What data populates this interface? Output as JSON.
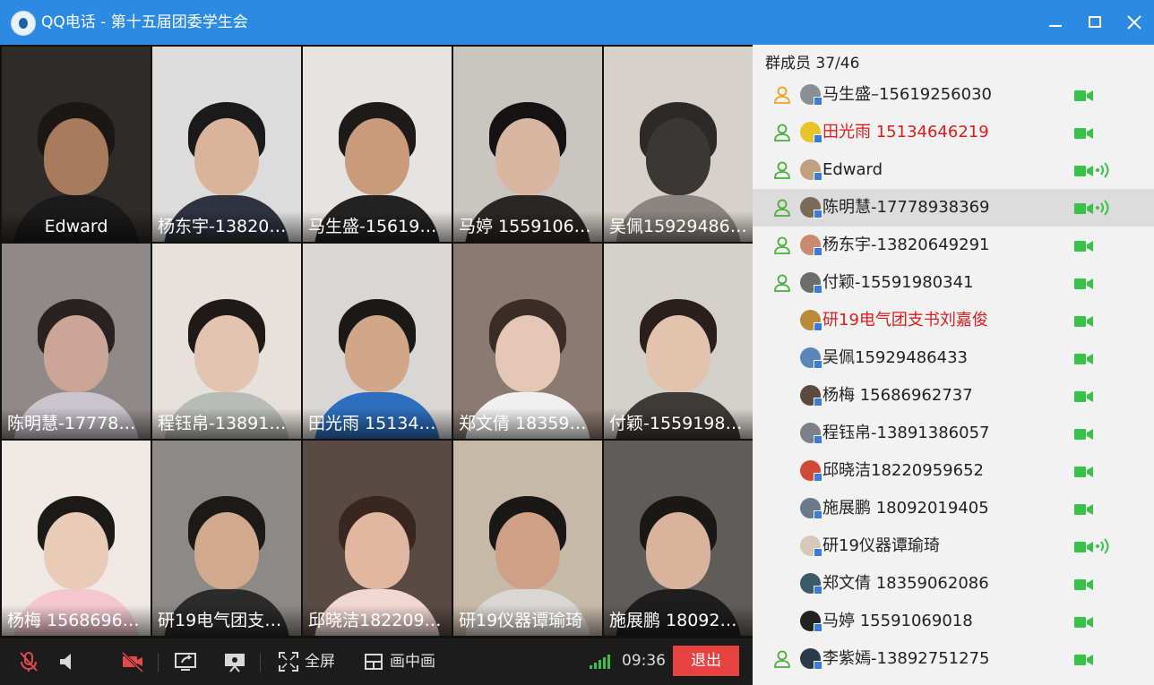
{
  "window": {
    "title": "QQ电话  -  第十五届团委学生会"
  },
  "tiles": [
    {
      "label": "Edward",
      "bg": "#2e2b28",
      "skin": "#a87b5c",
      "hair": "#1a1715",
      "shirt": "#1a1a1a",
      "center": true
    },
    {
      "label": "杨东宇-13820649291",
      "bg": "#dcdcdc",
      "skin": "#d9b39a",
      "hair": "#1b1a1a",
      "shirt": "#2f3340"
    },
    {
      "label": "马生盛-15619256030",
      "bg": "#e6e4e2",
      "skin": "#c99b7a",
      "hair": "#1c1b1a",
      "shirt": "#222222"
    },
    {
      "label": "马婷  15591069018",
      "bg": "#c9c5c0",
      "skin": "#d8b6a2",
      "hair": "#141212",
      "shirt": "#2a2626"
    },
    {
      "label": "吴佩15929486433",
      "bg": "#d6d2cb",
      "skin": "#3a3835",
      "hair": "#2b2a28",
      "shirt": "#8a8580"
    },
    {
      "label": "陈明慧-17778938369",
      "bg": "#8f8a88",
      "skin": "#cba596",
      "hair": "#2a2222",
      "shirt": "#c9c5cc"
    },
    {
      "label": "程钰帛-13891386057",
      "bg": "#e6e1da",
      "skin": "#e2c4b0",
      "hair": "#1e1a18",
      "shirt": "#b9bbb8"
    },
    {
      "label": "田光雨 15134646219",
      "bg": "#d9d7d6",
      "skin": "#d2a788",
      "hair": "#1b1918",
      "shirt": "#2c6fbe"
    },
    {
      "label": "郑文倩 18359062086",
      "bg": "#8b7a70",
      "skin": "#e4c7b5",
      "hair": "#3a2d28",
      "shirt": "#f0f0f0"
    },
    {
      "label": "付颖-15591980341",
      "bg": "#d3d1c9",
      "skin": "#e2c3ad",
      "hair": "#2a1f1a",
      "shirt": "#3d3b38"
    },
    {
      "label": "杨梅 15686962737",
      "bg": "#efe8e5",
      "skin": "#e8ccb8",
      "hair": "#1c1a19",
      "shirt": "#f4c7d0"
    },
    {
      "label": "研19电气团支书刘嘉俊",
      "bg": "#8c8a86",
      "skin": "#d1a98e",
      "hair": "#1b1a19",
      "shirt": "#2b2b2b"
    },
    {
      "label": "邱晓洁18220959652",
      "bg": "#5a4a44",
      "skin": "#e0b8a2",
      "hair": "#3a2620",
      "shirt": "#f2d6d2"
    },
    {
      "label": "研19仪器谭瑜琦",
      "bg": "#c7b9a8",
      "skin": "#cfa085",
      "hair": "#1a1816",
      "shirt": "#d9d7d3"
    },
    {
      "label": "施展鹏 18092019405",
      "bg": "#5f5d5a",
      "skin": "#d9b39c",
      "hair": "#1a1816",
      "shirt": "#1e1e1e"
    }
  ],
  "toolbar": {
    "fullscreen": "全屏",
    "pip": "画中画",
    "time": "09:36",
    "quit": "退出"
  },
  "members_header": "群成员 37/46",
  "members": [
    {
      "name": "马生盛–15619256030",
      "host": true,
      "hostColor": "#f0a318",
      "red": false,
      "voice": false,
      "selected": false,
      "av": "#8a8f95"
    },
    {
      "name": "田光雨 15134646219",
      "host": true,
      "hostColor": "#4caf3c",
      "red": true,
      "voice": false,
      "selected": false,
      "av": "#e8c32a"
    },
    {
      "name": "Edward",
      "host": true,
      "hostColor": "#4caf3c",
      "red": false,
      "voice": true,
      "selected": false,
      "av": "#c0a080"
    },
    {
      "name": "陈明慧-17778938369",
      "host": true,
      "hostColor": "#4caf3c",
      "red": false,
      "voice": true,
      "selected": true,
      "av": "#7a6a58"
    },
    {
      "name": "杨东宇-13820649291",
      "host": true,
      "hostColor": "#4caf3c",
      "red": false,
      "voice": false,
      "selected": false,
      "av": "#c98a70"
    },
    {
      "name": "付颖-15591980341",
      "host": true,
      "hostColor": "#4caf3c",
      "red": false,
      "voice": false,
      "selected": false,
      "av": "#6d6d6d"
    },
    {
      "name": "研19电气团支书刘嘉俊",
      "host": false,
      "red": true,
      "voice": false,
      "selected": false,
      "av": "#b88a3a"
    },
    {
      "name": "吴佩15929486433",
      "host": false,
      "red": false,
      "voice": false,
      "selected": false,
      "av": "#5a86b8"
    },
    {
      "name": "杨梅 15686962737",
      "host": false,
      "red": false,
      "voice": false,
      "selected": false,
      "av": "#5a4a40"
    },
    {
      "name": "程钰帛-13891386057",
      "host": false,
      "red": false,
      "voice": false,
      "selected": false,
      "av": "#7d8088"
    },
    {
      "name": "邱晓洁18220959652",
      "host": false,
      "red": false,
      "voice": false,
      "selected": false,
      "av": "#d04a3a"
    },
    {
      "name": "施展鹏 18092019405",
      "host": false,
      "red": false,
      "voice": false,
      "selected": false,
      "av": "#6a7a8a"
    },
    {
      "name": "研19仪器谭瑜琦",
      "host": false,
      "red": false,
      "voice": true,
      "selected": false,
      "av": "#d9c8b8"
    },
    {
      "name": "郑文倩 18359062086",
      "host": false,
      "red": false,
      "voice": false,
      "selected": false,
      "av": "#3a5a6a"
    },
    {
      "name": "马婷  15591069018",
      "host": false,
      "red": false,
      "voice": false,
      "selected": false,
      "av": "#222222"
    },
    {
      "name": "李紫嫣-13892751275",
      "host": true,
      "hostColor": "#4caf3c",
      "red": false,
      "voice": false,
      "selected": false,
      "av": "#2a3a4a"
    }
  ],
  "colors": {
    "titlebar": "#2b8be2",
    "accent_green": "#39c24a",
    "quit_red": "#e64240",
    "name_red": "#e21b1b"
  }
}
